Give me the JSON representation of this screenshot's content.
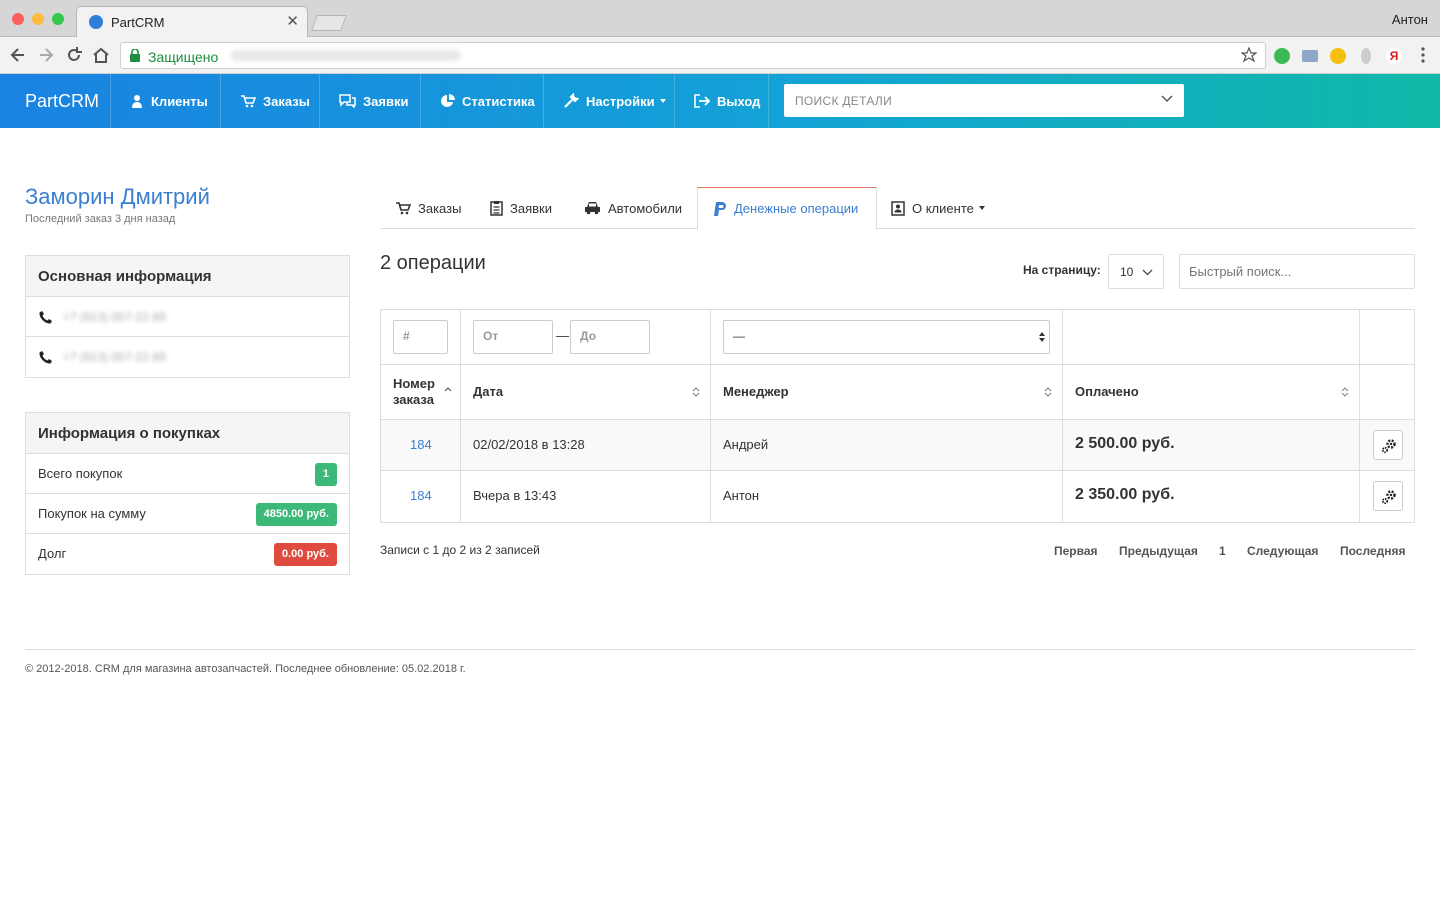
{
  "browser": {
    "tab_title": "PartCRM",
    "tab_close": "✕",
    "profile_name": "Антон",
    "secure_label": "Защищено"
  },
  "nav": {
    "brand": "PartCRM",
    "items": [
      {
        "label": "Клиенты",
        "icon": "user-icon"
      },
      {
        "label": "Заказы",
        "icon": "cart-icon"
      },
      {
        "label": "Заявки",
        "icon": "comments-icon"
      },
      {
        "label": "Статистика",
        "icon": "pie-chart-icon"
      },
      {
        "label": "Настройки",
        "icon": "wrench-icon"
      },
      {
        "label": "Выход",
        "icon": "logout-icon"
      }
    ],
    "search_placeholder": "ПОИСК ДЕТАЛИ"
  },
  "client": {
    "name": "Заморин Дмитрий",
    "last_order": "Последний заказ 3 дня назад"
  },
  "basic_info": {
    "title": "Основная информация",
    "phones": [
      "+7 (913) 057-22-89",
      "+7 (913) 057-22-89"
    ]
  },
  "purchases": {
    "title": "Информация о покупках",
    "rows": [
      {
        "label": "Всего покупок",
        "value": "1",
        "color": "#3cb878"
      },
      {
        "label": "Покупок на сумму",
        "value": "4850.00 руб.",
        "color": "#3cb878"
      },
      {
        "label": "Долг",
        "value": "0.00 руб.",
        "color": "#e04b3f"
      }
    ]
  },
  "tabs": [
    {
      "label": "Заказы",
      "icon": "cart-icon",
      "active": false
    },
    {
      "label": "Заявки",
      "icon": "clipboard-icon",
      "active": false
    },
    {
      "label": "Автомобили",
      "icon": "car-icon",
      "active": false
    },
    {
      "label": "Денежные операции",
      "icon": "paypal-icon",
      "active": true
    },
    {
      "label": "О клиенте",
      "icon": "contact-card-icon",
      "active": false
    }
  ],
  "operations": {
    "title": "2 операции",
    "per_page_label": "На страницу:",
    "per_page_value": "10",
    "quick_search_placeholder": "Быстрый поиск..."
  },
  "filters": {
    "number_placeholder": "#",
    "date_from": "От",
    "date_sep": "—",
    "date_to": "До",
    "manager_selected": "—"
  },
  "columns": {
    "number": "Номер заказа",
    "date": "Дата",
    "manager": "Менеджер",
    "paid": "Оплачено"
  },
  "rows": [
    {
      "number": "184",
      "date": "02/02/2018 в 13:28",
      "manager": "Андрей",
      "paid": "2 500.00 руб."
    },
    {
      "number": "184",
      "date": "Вчера в 13:43",
      "manager": "Антон",
      "paid": "2 350.00 руб."
    }
  ],
  "table_info": "Записи с 1 до 2 из 2 записей",
  "pagination": {
    "first": "Первая",
    "prev": "Предыдущая",
    "page": "1",
    "next": "Следующая",
    "last": "Последняя"
  },
  "footer": "© 2012-2018. CRM для магазина автозапчастей. Последнее обновление: 05.02.2018 г."
}
